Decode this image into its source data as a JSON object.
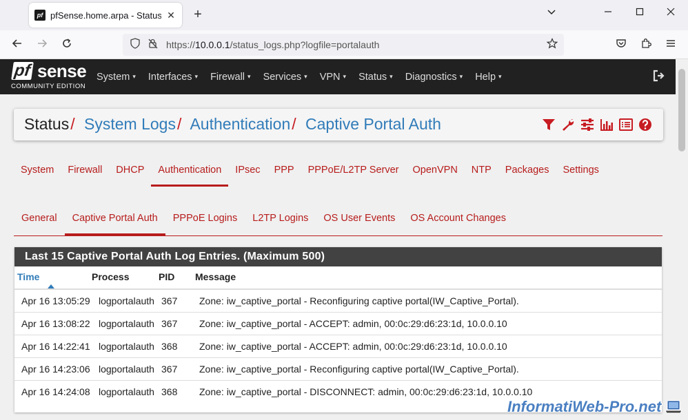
{
  "browser": {
    "tab_title": "pfSense.home.arpa - Status: System Logs: Authentication: Captive Portal Auth",
    "favicon_text": "pf",
    "url_prefix": "https://",
    "url_host": "10.0.0.1",
    "url_path": "/status_logs.php?logfile=portalauth",
    "new_tab_glyph": "+",
    "close_glyph": "✕"
  },
  "header": {
    "logo_pf": "pf",
    "logo_sense": "sense",
    "logo_edition": "COMMUNITY EDITION",
    "menu": [
      {
        "label": "System"
      },
      {
        "label": "Interfaces"
      },
      {
        "label": "Firewall"
      },
      {
        "label": "Services"
      },
      {
        "label": "VPN"
      },
      {
        "label": "Status"
      },
      {
        "label": "Diagnostics"
      },
      {
        "label": "Help"
      }
    ],
    "caret": "▾"
  },
  "breadcrumb": {
    "first": "Status",
    "links": [
      "System Logs",
      "Authentication",
      "Captive Portal Auth"
    ],
    "separator": "/"
  },
  "tools": [
    "filter-icon",
    "wrench-icon",
    "sliders-icon",
    "bar-chart-icon",
    "list-icon",
    "help-icon"
  ],
  "log_tabs": [
    {
      "label": "System",
      "active": false
    },
    {
      "label": "Firewall",
      "active": false
    },
    {
      "label": "DHCP",
      "active": false
    },
    {
      "label": "Authentication",
      "active": true
    },
    {
      "label": "IPsec",
      "active": false
    },
    {
      "label": "PPP",
      "active": false
    },
    {
      "label": "PPPoE/L2TP Server",
      "active": false
    },
    {
      "label": "OpenVPN",
      "active": false
    },
    {
      "label": "NTP",
      "active": false
    },
    {
      "label": "Packages",
      "active": false
    },
    {
      "label": "Settings",
      "active": false
    }
  ],
  "sub_tabs": [
    {
      "label": "General",
      "active": false
    },
    {
      "label": "Captive Portal Auth",
      "active": true
    },
    {
      "label": "PPPoE Logins",
      "active": false
    },
    {
      "label": "L2TP Logins",
      "active": false
    },
    {
      "label": "OS User Events",
      "active": false
    },
    {
      "label": "OS Account Changes",
      "active": false
    }
  ],
  "log_panel": {
    "heading": "Last 15 Captive Portal Auth Log Entries. (Maximum 500)",
    "columns": [
      "Time",
      "Process",
      "PID",
      "Message"
    ],
    "rows": [
      {
        "time": "Apr 16 13:05:29",
        "process": "logportalauth",
        "pid": "367",
        "message": "Zone: iw_captive_portal - Reconfiguring captive portal(IW_Captive_Portal)."
      },
      {
        "time": "Apr 16 13:08:22",
        "process": "logportalauth",
        "pid": "367",
        "message": "Zone: iw_captive_portal - ACCEPT: admin, 00:0c:29:d6:23:1d, 10.0.0.10"
      },
      {
        "time": "Apr 16 14:22:41",
        "process": "logportalauth",
        "pid": "368",
        "message": "Zone: iw_captive_portal - ACCEPT: admin, 00:0c:29:d6:23:1d, 10.0.0.10"
      },
      {
        "time": "Apr 16 14:23:06",
        "process": "logportalauth",
        "pid": "367",
        "message": "Zone: iw_captive_portal - Reconfiguring captive portal(IW_Captive_Portal)."
      },
      {
        "time": "Apr 16 14:24:08",
        "process": "logportalauth",
        "pid": "368",
        "message": "Zone: iw_captive_portal - DISCONNECT: admin, 00:0c:29:d6:23:1d, 10.0.0.10"
      }
    ]
  },
  "watermark": "InformatiWeb-Pro.net",
  "colors": {
    "accent_red": "#b71c1c",
    "link_blue": "#317cb9",
    "header_dark": "#212121",
    "panel_heading": "#424242"
  }
}
